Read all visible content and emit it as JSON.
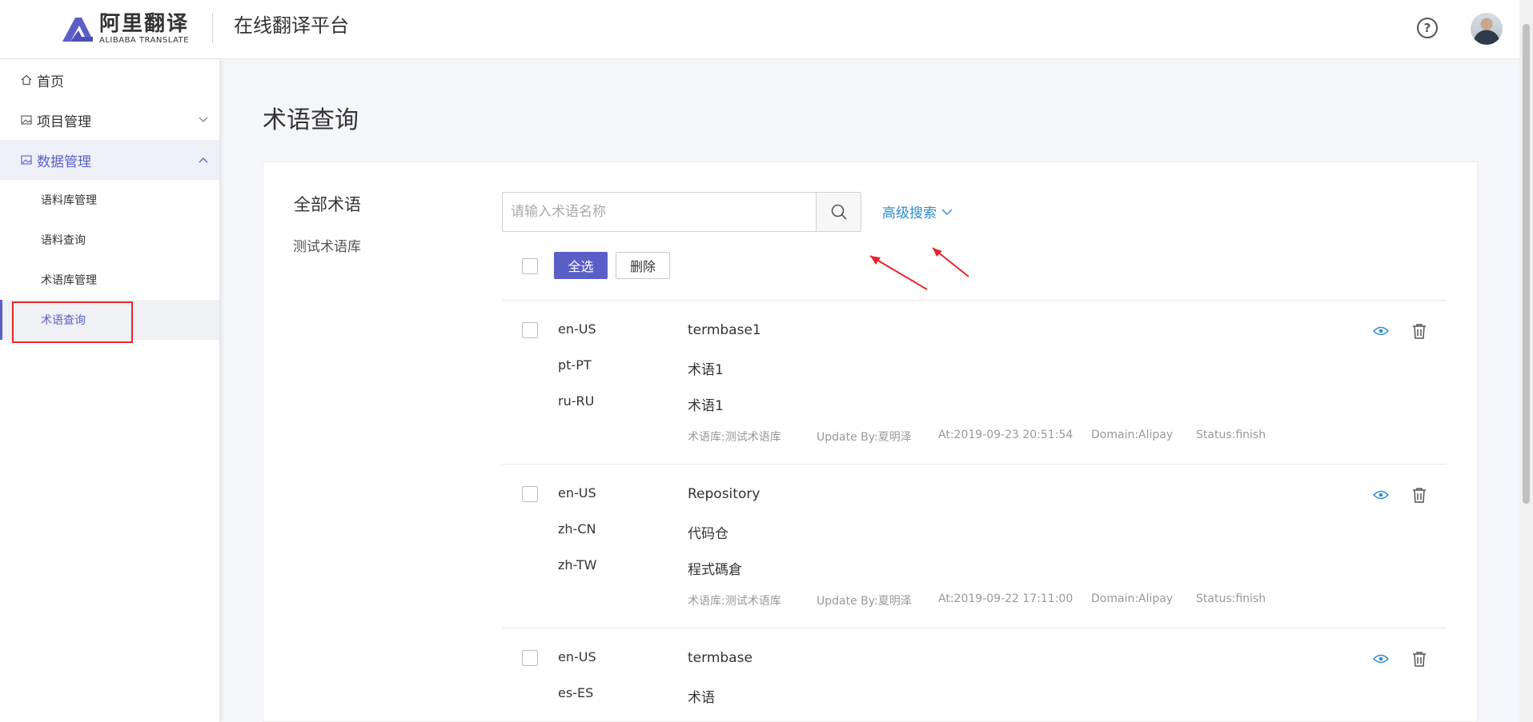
{
  "header": {
    "logo_cn": "阿里翻译",
    "logo_en": "ALIBABA TRANSLATE",
    "platform_title": "在线翻译平台",
    "help_icon": "question-icon",
    "avatar_icon": "user-avatar"
  },
  "sidebar": {
    "items": [
      {
        "label": "首页",
        "icon": "home-icon"
      },
      {
        "label": "项目管理",
        "icon": "image-icon",
        "chevron": "chevron-down-icon"
      },
      {
        "label": "数据管理",
        "icon": "image-icon",
        "chevron": "chevron-up-icon"
      }
    ],
    "sub_items": [
      {
        "label": "语料库管理"
      },
      {
        "label": "语料查询"
      },
      {
        "label": "术语库管理"
      },
      {
        "label": "术语查询"
      }
    ]
  },
  "main": {
    "page_title": "术语查询",
    "library_title": "全部术语",
    "library_sub": "测试术语库",
    "search": {
      "placeholder": "请输入术语名称",
      "icon": "search-icon"
    },
    "advanced_search": "高级搜索",
    "select_all": "全选",
    "delete": "删除"
  },
  "entries": [
    {
      "langs": [
        "en-US",
        "pt-PT",
        "ru-RU"
      ],
      "terms": [
        "termbase1",
        "术语1",
        "术语1"
      ],
      "termbase": "术语库:测试术语库",
      "update_by": "Update By:夏明泽",
      "at": "At:2019-09-23 20:51:54",
      "domain": "Domain:Alipay",
      "status": "Status:finish"
    },
    {
      "langs": [
        "en-US",
        "zh-CN",
        "zh-TW"
      ],
      "terms": [
        "Repository",
        "代码仓",
        "程式碼倉"
      ],
      "termbase": "术语库:测试术语库",
      "update_by": "Update By:夏明泽",
      "at": "At:2019-09-22 17:11:00",
      "domain": "Domain:Alipay",
      "status": "Status:finish"
    },
    {
      "langs": [
        "en-US",
        "es-ES"
      ],
      "terms": [
        "termbase",
        "术语"
      ]
    }
  ],
  "colors": {
    "accent": "#5a5fc7",
    "link": "#2d8ccf",
    "annotation_red": "#e8262d"
  }
}
